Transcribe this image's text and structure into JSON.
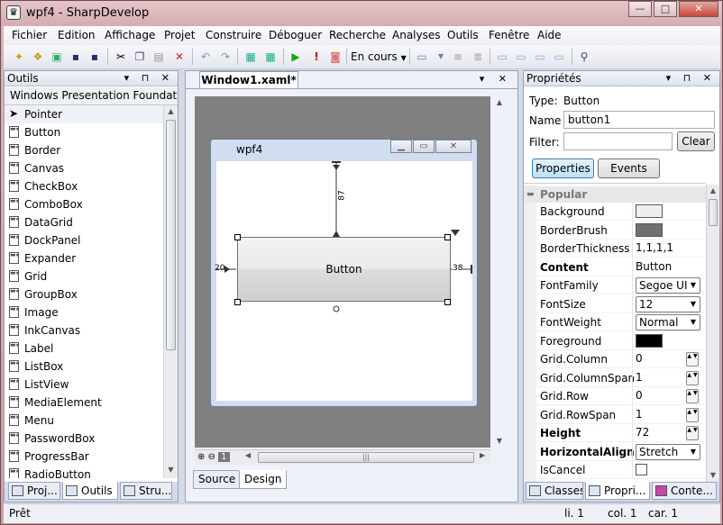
{
  "window": {
    "title": "wpf4 - SharpDevelop",
    "min": "—",
    "max": "□",
    "close": "✕",
    "icon_glyph": "♛"
  },
  "menu": [
    "Fichier",
    "Edition",
    "Affichage",
    "Projet",
    "Construire",
    "Déboguer",
    "Recherche",
    "Analyses",
    "Outils",
    "Fenêtre",
    "Aide"
  ],
  "toolbar": {
    "config": "En cours",
    "icons": [
      "new-file-icon",
      "new-project-icon",
      "open-icon",
      "save-icon",
      "save-all-icon",
      "cut-icon",
      "copy-icon",
      "paste-icon",
      "delete-icon",
      "undo-icon",
      "redo-icon",
      "build-icon",
      "build-all-icon",
      "run-icon",
      "debug-break-icon",
      "stop-icon",
      "find-icon"
    ]
  },
  "left": {
    "title": "Outils",
    "pin": "▾ ⊓ ✕",
    "category": "Windows Presentation Foundatio",
    "items": [
      "Pointer",
      "Button",
      "Border",
      "Canvas",
      "CheckBox",
      "ComboBox",
      "DataGrid",
      "DockPanel",
      "Expander",
      "Grid",
      "GroupBox",
      "Image",
      "InkCanvas",
      "Label",
      "ListBox",
      "ListView",
      "MediaElement",
      "Menu",
      "PasswordBox",
      "ProgressBar",
      "RadioButton"
    ],
    "tabs": [
      "Proj...",
      "Outils",
      "Stru..."
    ]
  },
  "doc": {
    "tab": "Window1.xaml*",
    "btns": "▾ ✕",
    "window_title": "wpf4",
    "button_text": "Button",
    "margin_top": "87",
    "margin_left": "20",
    "margin_right": "38",
    "zoom": "1",
    "tabs": [
      "Source",
      "Design"
    ]
  },
  "right": {
    "title": "Propriétés",
    "pin": "▾ ⊓ ✕",
    "type_label": "Type:",
    "type_value": "Button",
    "name_label": "Name",
    "name_value": "button1",
    "filter_label": "Filter:",
    "filter_value": "",
    "clear": "Clear",
    "tab_properties": "Properties",
    "tab_events": "Events",
    "category": "Popular",
    "props": [
      {
        "k": "Background",
        "v": "",
        "kind": "swatch",
        "color": "#efefef"
      },
      {
        "k": "BorderBrush",
        "v": "",
        "kind": "swatch",
        "color": "#707070"
      },
      {
        "k": "BorderThickness",
        "v": "1,1,1,1",
        "kind": "text"
      },
      {
        "k": "Content",
        "v": "Button",
        "kind": "text",
        "bold": true
      },
      {
        "k": "FontFamily",
        "v": "Segoe UI",
        "kind": "combo"
      },
      {
        "k": "FontSize",
        "v": "12",
        "kind": "combo"
      },
      {
        "k": "FontWeight",
        "v": "Normal",
        "kind": "combo"
      },
      {
        "k": "Foreground",
        "v": "",
        "kind": "swatch",
        "color": "#000000"
      },
      {
        "k": "Grid.Column",
        "v": "0",
        "kind": "spin"
      },
      {
        "k": "Grid.ColumnSpan",
        "v": "1",
        "kind": "spin"
      },
      {
        "k": "Grid.Row",
        "v": "0",
        "kind": "spin"
      },
      {
        "k": "Grid.RowSpan",
        "v": "1",
        "kind": "spin"
      },
      {
        "k": "Height",
        "v": "72",
        "kind": "spin",
        "bold": true
      },
      {
        "k": "HorizontalAlign...",
        "v": "Stretch",
        "kind": "combo",
        "bold": true
      },
      {
        "k": "IsCancel",
        "v": "",
        "kind": "check"
      }
    ],
    "tabs": [
      "Classes",
      "Propri...",
      "Conte..."
    ]
  },
  "status": {
    "text": "Prêt",
    "line": "li. 1",
    "col": "col. 1",
    "car": "car. 1"
  }
}
